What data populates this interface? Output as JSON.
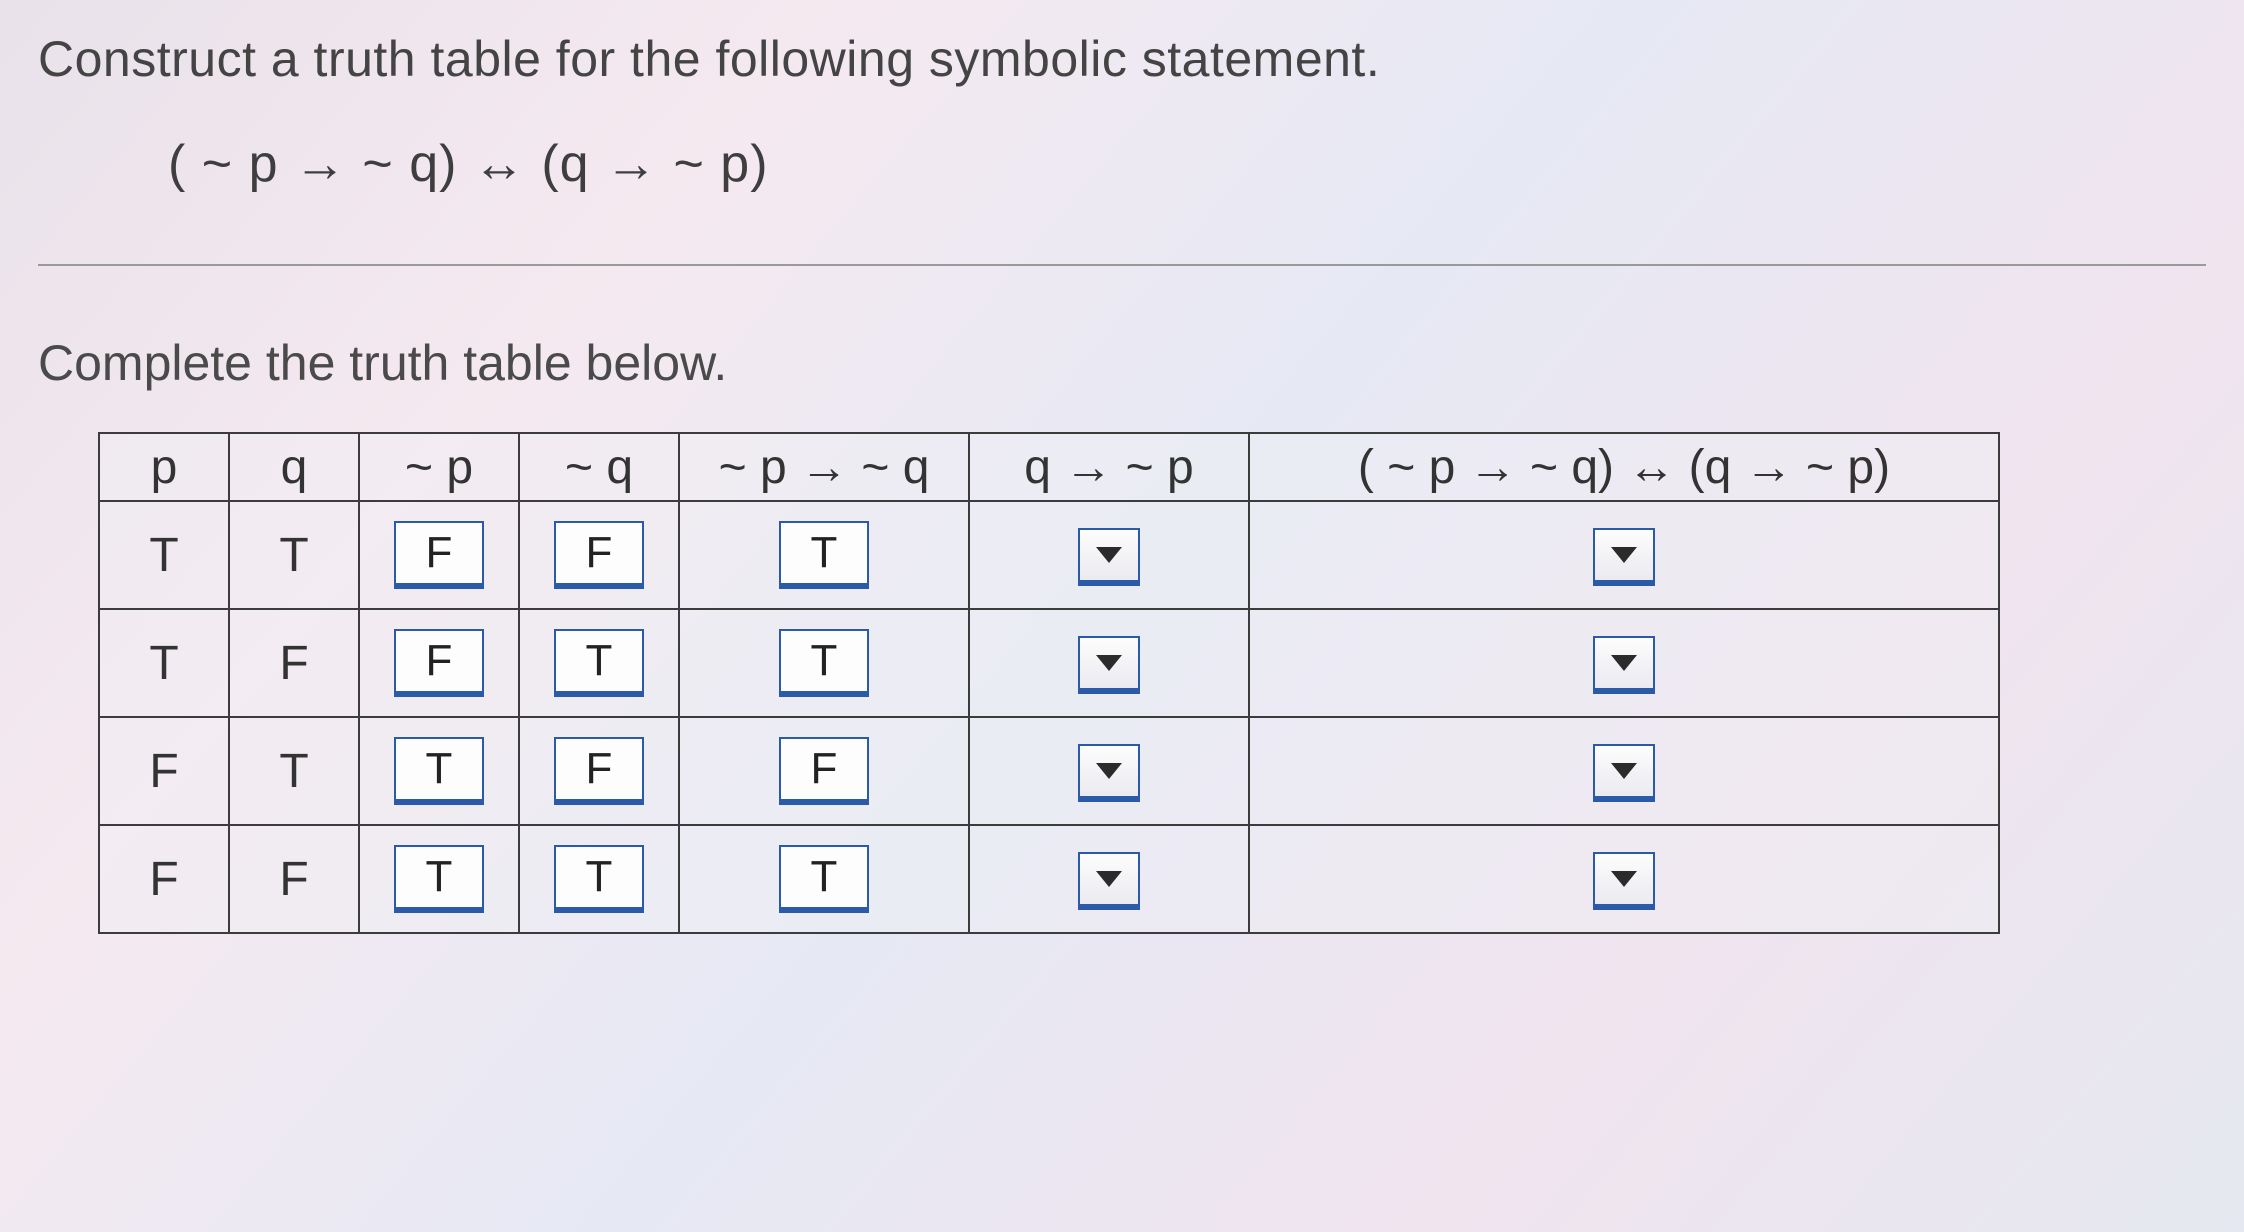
{
  "instruction": "Construct a truth table for the following symbolic statement.",
  "expression": "( ~ p → ~ q) ↔ (q → ~ p)",
  "subinstruction": "Complete the truth table below.",
  "headers": {
    "p": "p",
    "q": "q",
    "np": "~ p",
    "nq": "~ q",
    "imp1": "~ p → ~ q",
    "imp2": "q → ~ p",
    "bic": "( ~ p → ~ q) ↔ (q → ~ p)"
  },
  "rows": [
    {
      "p": "T",
      "q": "T",
      "np": "F",
      "nq": "F",
      "imp1": "T",
      "imp2": "",
      "bic": ""
    },
    {
      "p": "T",
      "q": "F",
      "np": "F",
      "nq": "T",
      "imp1": "T",
      "imp2": "",
      "bic": ""
    },
    {
      "p": "F",
      "q": "T",
      "np": "T",
      "nq": "F",
      "imp1": "F",
      "imp2": "",
      "bic": ""
    },
    {
      "p": "F",
      "q": "F",
      "np": "T",
      "nq": "T",
      "imp1": "T",
      "imp2": "",
      "bic": ""
    }
  ],
  "chart_data": {
    "type": "table",
    "title": "Truth table for (~p → ~q) ↔ (q → ~p)",
    "columns": [
      "p",
      "q",
      "~p",
      "~q",
      "~p → ~q",
      "q → ~p",
      "(~p → ~q) ↔ (q → ~p)"
    ],
    "data": [
      [
        "T",
        "T",
        "F",
        "F",
        "T",
        null,
        null
      ],
      [
        "T",
        "F",
        "F",
        "T",
        "T",
        null,
        null
      ],
      [
        "F",
        "T",
        "T",
        "F",
        "F",
        null,
        null
      ],
      [
        "F",
        "F",
        "T",
        "T",
        "T",
        null,
        null
      ]
    ]
  }
}
